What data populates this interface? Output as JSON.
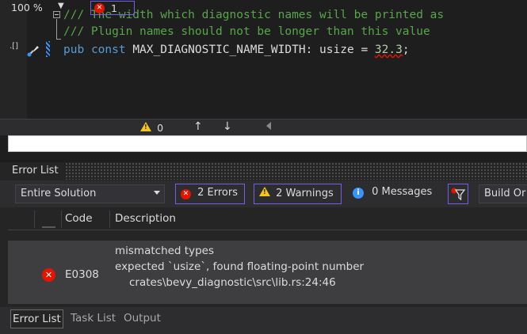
{
  "editor": {
    "line1_comment": "/// The width which diagnostic names will be printed as",
    "line2_comment": "/// Plugin names should not be longer than this value",
    "line3": {
      "kw1": "pub",
      "kw2": "const",
      "name": "MAX_DIAGNOSTIC_NAME_WIDTH",
      "colon": ":",
      "type": "usize",
      "eq": "=",
      "value": "32.3",
      "semi": ";"
    },
    "margin_glyph": ".[]"
  },
  "status": {
    "zoom": "100 %",
    "error_count": "1",
    "warning_count": "0"
  },
  "error_list": {
    "title": "Error List",
    "scope": "Entire Solution",
    "errors_label": "2 Errors",
    "warnings_label": "2 Warnings",
    "messages_label": "0 Messages",
    "build_label": "Build Or",
    "columns": {
      "code": "Code",
      "description": "Description"
    },
    "rows": [
      {
        "code": "E0308",
        "line1": "mismatched types",
        "line2": "expected `usize`, found floating-point number",
        "line3": "crates\\bevy_diagnostic\\src\\lib.rs:24:46"
      }
    ]
  },
  "bottom_tabs": [
    "Error List",
    "Task List",
    "Output"
  ],
  "colors": {
    "comment": "#57a64a",
    "keyword": "#569cd6",
    "error": "#e51400",
    "warning": "#f5c517",
    "focus": "#7160e8"
  }
}
